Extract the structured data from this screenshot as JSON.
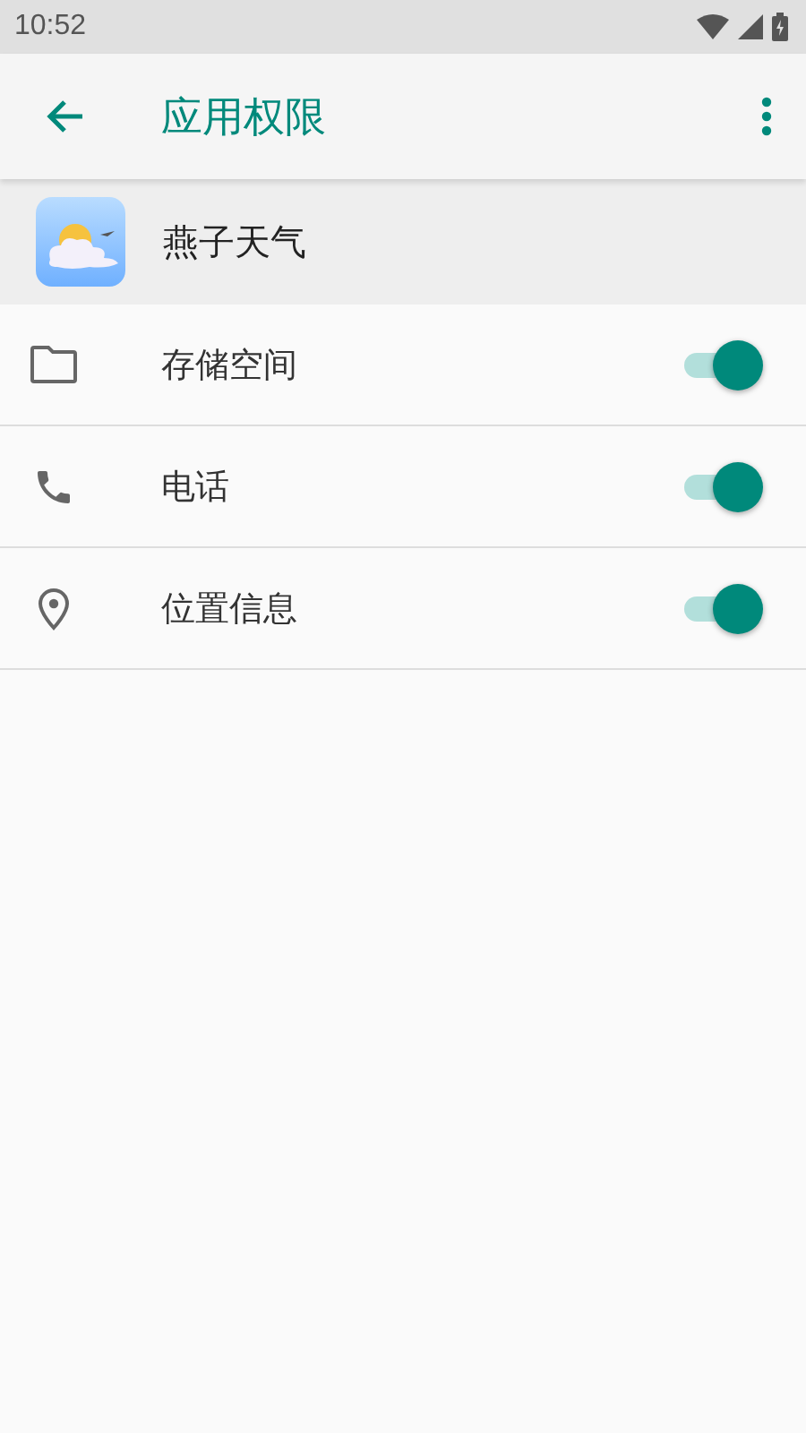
{
  "status_bar": {
    "time": "10:52"
  },
  "toolbar": {
    "title": "应用权限"
  },
  "app": {
    "name": "燕子天气"
  },
  "permissions": [
    {
      "kind": "storage",
      "label": "存储空间",
      "on": true
    },
    {
      "kind": "phone",
      "label": "电话",
      "on": true
    },
    {
      "kind": "location",
      "label": "位置信息",
      "on": true
    }
  ]
}
